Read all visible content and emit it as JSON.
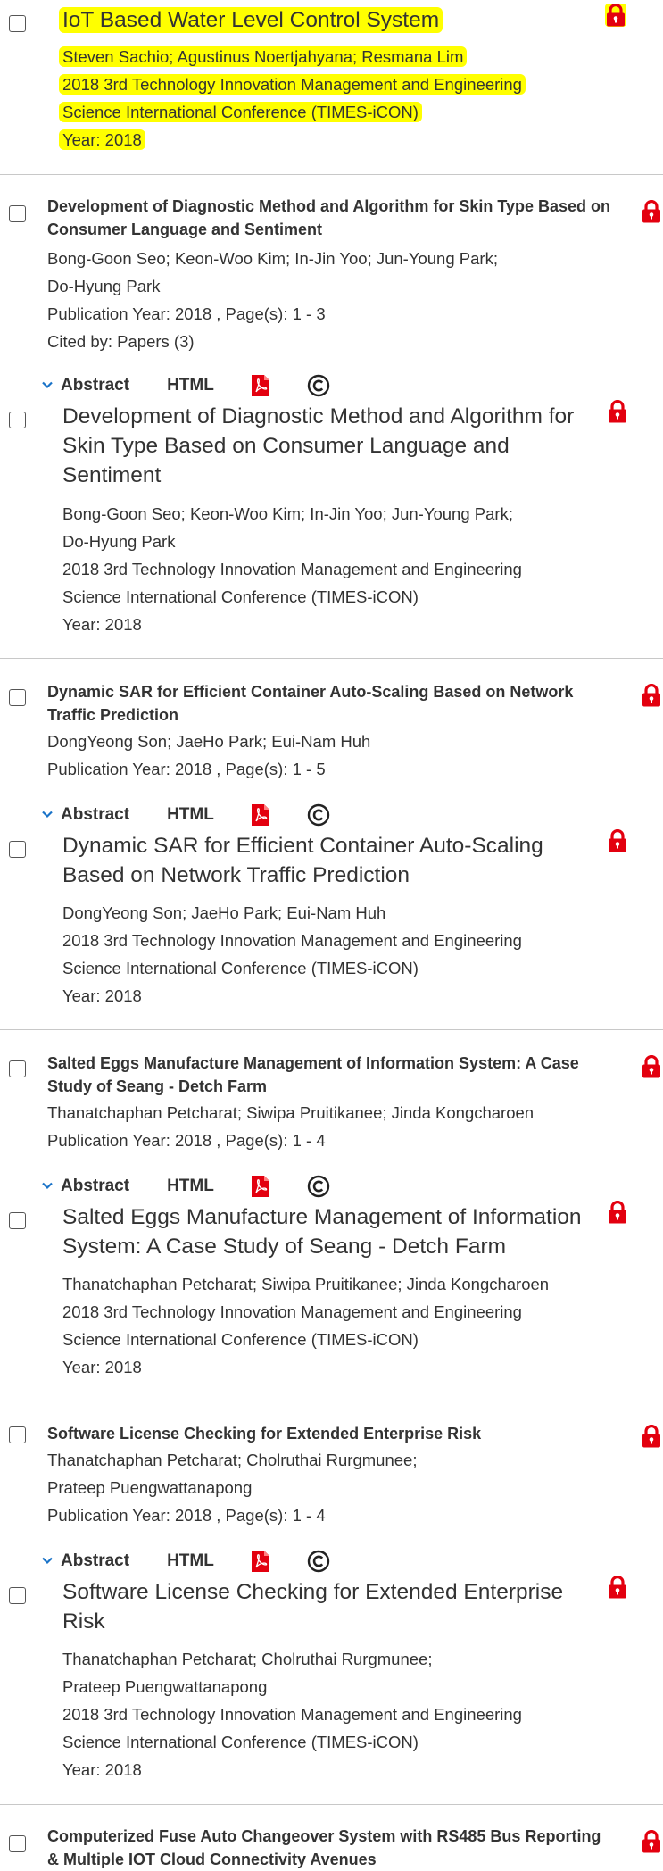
{
  "top_item": {
    "title": "IoT Based Water Level Control System",
    "authors": "Steven Sachio; Agustinus Noertjahyana; Resmana Lim",
    "conference_line1": "2018 3rd Technology Innovation Management and Engineering",
    "conference_line2": "Science International Conference (TIMES-iCON)",
    "year": "Year: 2018"
  },
  "actions": {
    "abstract": "Abstract",
    "html": "HTML"
  },
  "items": [
    {
      "title": "Development of Diagnostic Method and Algorithm for Skin Type Based on Consumer Language and Sentiment",
      "authors_line1": "Bong-Goon Seo; Keon-Woo Kim; In-Jin Yoo; Jun-Young Park;",
      "authors_line2": "Do-Hyung Park",
      "pub": "Publication Year: 2018 , Page(s): 1  -  3",
      "cited": "Cited by: Papers (3)",
      "expanded_title": "Development of Diagnostic Method and Algorithm for Skin Type Based on Consumer Language and Sentiment",
      "expanded_authors_line1": "Bong-Goon Seo; Keon-Woo Kim; In-Jin Yoo; Jun-Young Park;",
      "expanded_authors_line2": "Do-Hyung Park",
      "conference_line1": "2018 3rd Technology Innovation Management and Engineering",
      "conference_line2": "Science International Conference (TIMES-iCON)",
      "year": "Year: 2018"
    },
    {
      "title": "Dynamic SAR for Efficient Container Auto-Scaling Based on Network Traffic Prediction",
      "authors_line1": "DongYeong Son; JaeHo Park; Eui-Nam Huh",
      "pub": "Publication Year: 2018 , Page(s): 1  -  5",
      "expanded_title": "Dynamic SAR for Efficient Container Auto-Scaling Based on Network Traffic Prediction",
      "expanded_authors_line1": "DongYeong Son; JaeHo Park; Eui-Nam Huh",
      "conference_line1": "2018 3rd Technology Innovation Management and Engineering",
      "conference_line2": "Science International Conference (TIMES-iCON)",
      "year": "Year: 2018"
    },
    {
      "title": "Salted Eggs Manufacture Management of Information System: A Case Study of Seang - Detch Farm",
      "authors_line1": "Thanatchaphan Petcharat; Siwipa Pruitikanee; Jinda Kongcharoen",
      "pub": "Publication Year: 2018 , Page(s): 1  -  4",
      "expanded_title": "Salted Eggs Manufacture Management of Information System: A Case Study of Seang - Detch Farm",
      "expanded_authors_line1": "Thanatchaphan Petcharat; Siwipa Pruitikanee; Jinda Kongcharoen",
      "conference_line1": "2018 3rd Technology Innovation Management and Engineering",
      "conference_line2": "Science International Conference (TIMES-iCON)",
      "year": "Year: 2018"
    },
    {
      "title": "Software License Checking for Extended Enterprise Risk",
      "authors_line1": "Thanatchaphan Petcharat; Cholruthai Rurgmunee;",
      "authors_line2": "Prateep Puengwattanapong",
      "pub": "Publication Year: 2018 , Page(s): 1  -  4",
      "expanded_title": "Software License Checking for Extended Enterprise Risk",
      "expanded_authors_line1": "Thanatchaphan Petcharat; Cholruthai Rurgmunee;",
      "expanded_authors_line2": "Prateep Puengwattanapong",
      "conference_line1": "2018 3rd Technology Innovation Management and Engineering",
      "conference_line2": "Science International Conference (TIMES-iCON)",
      "year": "Year: 2018"
    },
    {
      "title": "Computerized Fuse Auto Changeover System with RS485 Bus Reporting & Multiple IOT Cloud Connectivity Avenues"
    }
  ],
  "icons": {
    "lock": "lock-icon",
    "pdf": "pdf-icon",
    "copyright": "copyright-icon",
    "chevron": "chevron-down-icon"
  },
  "colors": {
    "highlight": "#ffff00",
    "lock": "#e3000f",
    "pdf": "#e3000f",
    "chevron": "#1a73c8",
    "divider": "#c8c8c8"
  }
}
